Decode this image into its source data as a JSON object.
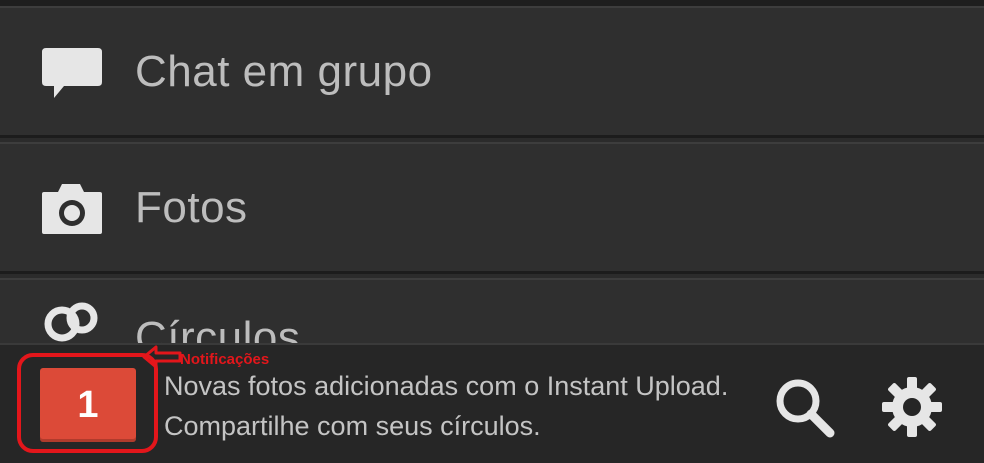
{
  "menu": {
    "items": [
      {
        "label": "Chat em grupo",
        "icon": "chat-bubble-icon"
      },
      {
        "label": "Fotos",
        "icon": "camera-icon"
      },
      {
        "label": "Círculos",
        "icon": "circles-icon"
      }
    ]
  },
  "notification": {
    "count": "1",
    "message": "Novas fotos adicionadas com o Instant Upload. Compartilhe com seus círculos.",
    "badge_color": "#dc4a38"
  },
  "annotation": {
    "label": "Notificações",
    "color": "#e3161b"
  },
  "toolbar": {
    "search_icon": "search-icon",
    "settings_icon": "gear-icon"
  }
}
